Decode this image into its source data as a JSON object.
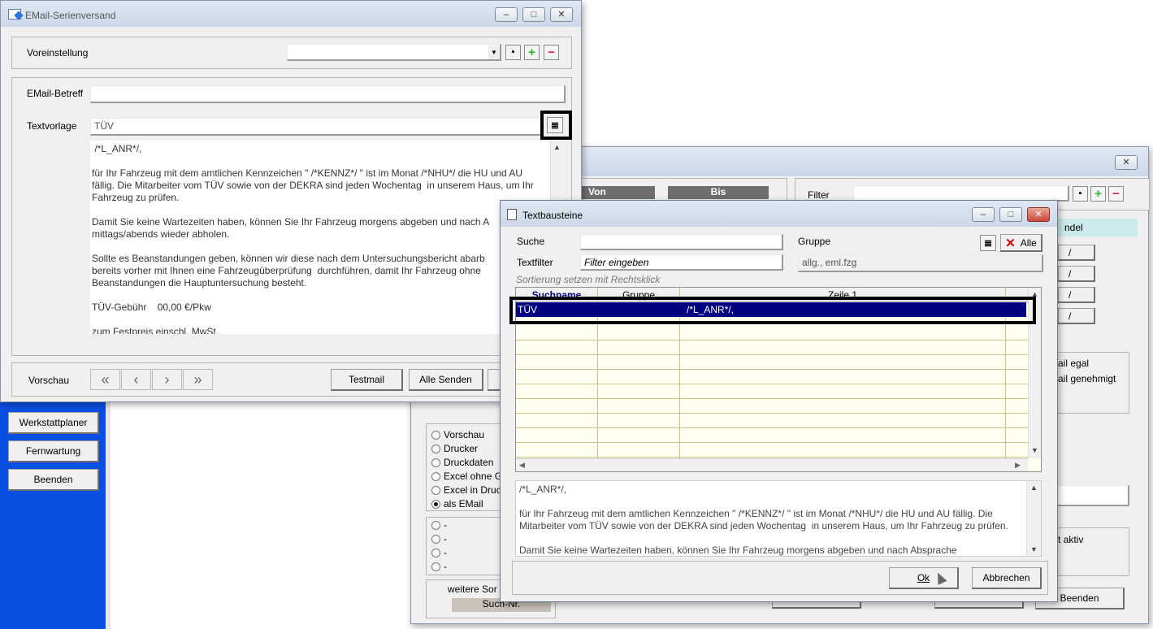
{
  "bg_window": {
    "col_von": "Von",
    "col_bis": "Bis",
    "filter_label": "Filter",
    "right_header": "ndel",
    "slash_fields": [
      "/",
      "/",
      "/",
      "/"
    ],
    "right_options": [
      "ail egal",
      "ail genehmigt"
    ],
    "aktiv_label": "t aktiv",
    "beenden": "Beenden",
    "output_options": [
      {
        "label": "Vorschau",
        "checked": false
      },
      {
        "label": "Drucker",
        "checked": false
      },
      {
        "label": "Druckdaten",
        "checked": false
      },
      {
        "label": "Excel ohne G",
        "checked": false
      },
      {
        "label": "Excel in Druc",
        "checked": false
      },
      {
        "label": "als EMail",
        "checked": true
      }
    ],
    "dash_options": [
      "-",
      "-",
      "-",
      "-"
    ],
    "weitere_label": "weitere Sor",
    "suchnr_label": "Such-Nr."
  },
  "left_app": {
    "buttons": [
      "Werkstattplaner",
      "Fernwartung",
      "Beenden"
    ]
  },
  "email_window": {
    "title": "EMail-Serienversand",
    "voreinstellung_label": "Voreinstellung",
    "voreinstellung_value": "",
    "betreff_label": "EMail-Betreff",
    "betreff_value": "",
    "textvorlage_label": "Textvorlage",
    "textvorlage_value": "TÜV",
    "body_text": " /*L_ANR*/,\n\nfür Ihr Fahrzeug mit dem amtlichen Kennzeichen \" /*KENNZ*/ \" ist im Monat /*NHU*/ die HU und AU\nfällig. Die Mitarbeiter vom TÜV sowie von der DEKRA sind jeden Wochentag  in unserem Haus, um Ihr\nFahrzeug zu prüfen.\n\nDamit Sie keine Wartezeiten haben, können Sie Ihr Fahrzeug morgens abgeben und nach A\nmittags/abends wieder abholen.\n\nSollte es Beanstandungen geben, können wir diese nach dem Untersuchungsbericht abarb\nbereits vorher mit Ihnen eine Fahrzeugüberprüfung  durchführen, damit Ihr Fahrzeug ohne\nBeanstandungen die Hauptuntersuchung besteht.\n\nTÜV-Gebühr    00,00 €/Pkw\n\nzum Festpreis einschl. MwSt.",
    "vorschau_label": "Vorschau",
    "testmail": "Testmail",
    "alle_senden": "Alle Senden"
  },
  "tb_window": {
    "title": "Textbausteine",
    "suche_label": "Suche",
    "suche_value": "",
    "gruppe_label": "Gruppe",
    "gruppe_value": "allg., eml.fzg",
    "alle_label": "Alle",
    "textfilter_label": "Textfilter",
    "textfilter_placeholder": "Filter eingeben",
    "sort_hint": "Sortierung setzen mit Rechtsklick",
    "columns": [
      "Suchname",
      "Gruppe",
      "Zeile 1"
    ],
    "rows": [
      {
        "suchname": "TÜV",
        "gruppe": "",
        "zeile1": "/*L_ANR*/,",
        "selected": true
      }
    ],
    "preview_text": "/*L_ANR*/,\n\nfür Ihr Fahrzeug mit dem amtlichen Kennzeichen \" /*KENNZ*/ \" ist im Monat /*NHU*/ die HU und AU fällig. Die\nMitarbeiter vom TÜV sowie von der DEKRA sind jeden Wochentag  in unserem Haus, um Ihr Fahrzeug zu prüfen.\n\nDamit Sie keine Wartezeiten haben, können Sie Ihr Fahrzeug morgens abgeben und nach Absprache",
    "ok": "Ok",
    "abbrechen": "Abbrechen"
  },
  "colors": {
    "selection": "#000080",
    "sidebar_blue": "#0a4fe0",
    "highlight_border": "#000000",
    "grid_line": "#c9c48a"
  }
}
